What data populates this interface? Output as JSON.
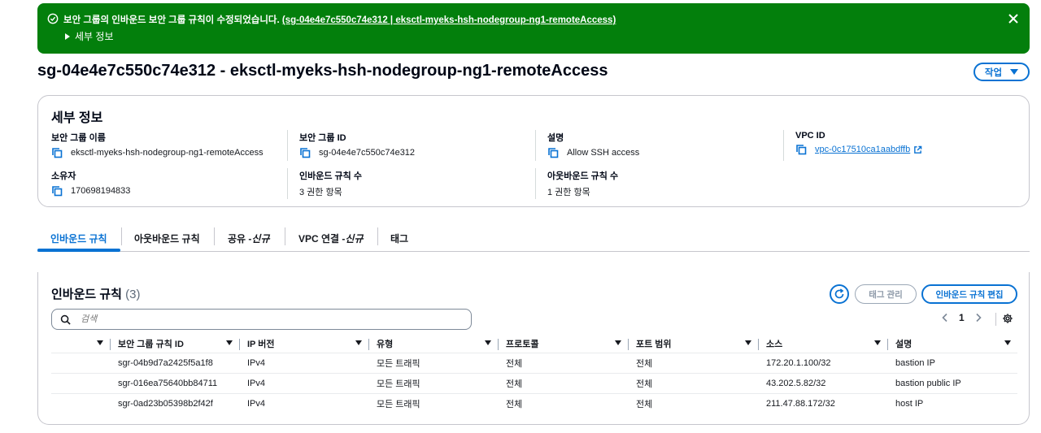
{
  "flash": {
    "message_prefix": "보안 그룹의 인바운드 보안 그룹 규칙이 수정되었습니다.",
    "message_link": "(sg-04e4e7c550c74e312 | eksctl-myeks-hsh-nodegroup-ng1-remoteAccess)",
    "details_label": "세부 정보",
    "color": "#037f0c"
  },
  "header": {
    "title": "sg-04e4e7c550c74e312 - eksctl-myeks-hsh-nodegroup-ng1-remoteAccess",
    "actions_label": "작업"
  },
  "details": {
    "title": "세부 정보",
    "sg_name_label": "보안 그룹 이름",
    "sg_name_value": "eksctl-myeks-hsh-nodegroup-ng1-remoteAccess",
    "sg_id_label": "보안 그룹 ID",
    "sg_id_value": "sg-04e4e7c550c74e312",
    "desc_label": "설명",
    "desc_value": "Allow SSH access",
    "vpc_label": "VPC ID",
    "vpc_value": "vpc-0c17510ca1aabdffb",
    "owner_label": "소유자",
    "owner_value": "170698194833",
    "inbound_count_label": "인바운드 규칙 수",
    "inbound_count_value": "3 권한 항목",
    "outbound_count_label": "아웃바운드 규칙 수",
    "outbound_count_value": "1 권한 항목"
  },
  "tabs": {
    "inbound": "인바운드 규칙",
    "outbound": "아웃바운드 규칙",
    "sharing": "공유 - ",
    "sharing_new": "신규",
    "vpc_assoc": "VPC 연결 - ",
    "vpc_assoc_new": "신규",
    "tags": "태그"
  },
  "rules": {
    "title": "인바운드 규칙",
    "count": "(3)",
    "manage_tags_label": "태그 관리",
    "edit_label": "인바운드 규칙 편집",
    "search_placeholder": "검색",
    "page": "1",
    "columns": [
      "",
      "보안 그룹 규칙 ID",
      "IP 버전",
      "유형",
      "프로토콜",
      "포트 범위",
      "소스",
      "설명"
    ],
    "rows": [
      {
        "id": "sgr-04b9d7a2425f5a1f8",
        "ipver": "IPv4",
        "type": "모든 트래픽",
        "proto": "전체",
        "port": "전체",
        "source": "172.20.1.100/32",
        "desc": "bastion IP"
      },
      {
        "id": "sgr-016ea75640bb84711",
        "ipver": "IPv4",
        "type": "모든 트래픽",
        "proto": "전체",
        "port": "전체",
        "source": "43.202.5.82/32",
        "desc": "bastion public IP"
      },
      {
        "id": "sgr-0ad23b05398b2f42f",
        "ipver": "IPv4",
        "type": "모든 트래픽",
        "proto": "전체",
        "port": "전체",
        "source": "211.47.88.172/32",
        "desc": "host IP"
      }
    ]
  }
}
